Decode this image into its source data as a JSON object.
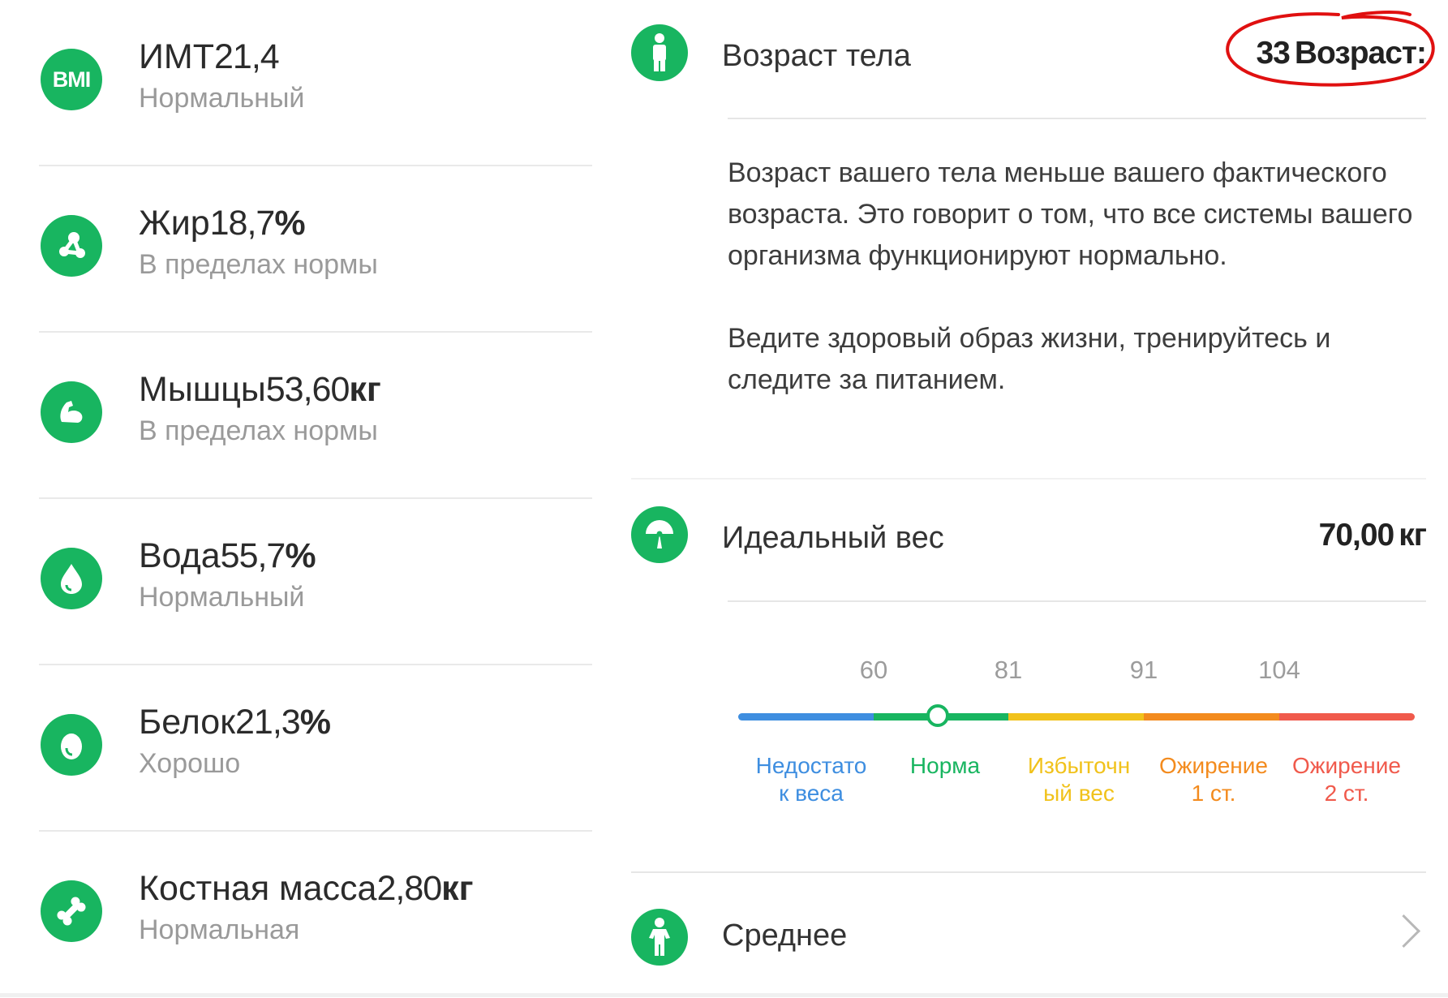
{
  "colors": {
    "accent": "#18b560",
    "underweight": "#3e8ee0",
    "normal": "#18b560",
    "overweight": "#f1c21b",
    "obese1": "#f38b1e",
    "obese2": "#f05a4c",
    "annotation": "#e01010"
  },
  "metrics": [
    {
      "icon": "bmi-icon",
      "name": "ИМТ",
      "value": "21,4",
      "unit": "",
      "status": "Нормальный"
    },
    {
      "icon": "fat-icon",
      "name": "Жир",
      "value": "18,7",
      "unit": "%",
      "status": "В пределах нормы"
    },
    {
      "icon": "muscle-icon",
      "name": "Мышцы",
      "value": "53,60",
      "unit": "кг",
      "status": "В пределах нормы"
    },
    {
      "icon": "water-drop-icon",
      "name": "Вода",
      "value": "55,7",
      "unit": "%",
      "status": "Нормальный"
    },
    {
      "icon": "protein-egg-icon",
      "name": "Белок",
      "value": "21,3",
      "unit": "%",
      "status": "Хорошо"
    },
    {
      "icon": "bone-icon",
      "name": "Костная масса",
      "value": "2,80",
      "unit": "кг",
      "status": "Нормальная"
    }
  ],
  "body_age": {
    "label": "Возраст тела",
    "value": "33",
    "value_suffix": "Возраст:",
    "description": [
      "Возраст вашего тела меньше вашего фактического возраста. Это говорит о том, что все системы вашего организма функционируют нормально.",
      "Ведите здоровый образ жизни, тренируйтесь и следите за питанием."
    ]
  },
  "ideal_weight": {
    "label": "Идеальный вес",
    "value": "70,00",
    "unit": "кг",
    "thresholds": [
      "60",
      "81",
      "91",
      "104"
    ],
    "marker_fraction": 0.295,
    "categories": [
      {
        "label_line1": "Недостато",
        "label_line2": "к веса",
        "color": "#3e8ee0"
      },
      {
        "label_line1": "Норма",
        "label_line2": "",
        "color": "#18b560"
      },
      {
        "label_line1": "Избыточн",
        "label_line2": "ый вес",
        "color": "#f1c21b"
      },
      {
        "label_line1": "Ожирение",
        "label_line2": "1 ст.",
        "color": "#f38b1e"
      },
      {
        "label_line1": "Ожирение",
        "label_line2": "2 ст.",
        "color": "#f05a4c"
      }
    ]
  },
  "body_type": {
    "label": "Среднее"
  }
}
